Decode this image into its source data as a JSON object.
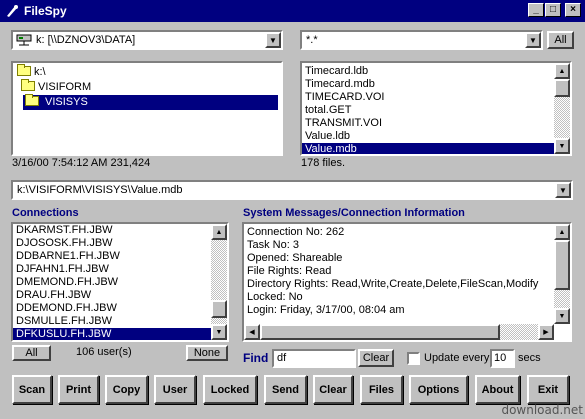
{
  "window": {
    "title": "FileSpy"
  },
  "drive_combo": {
    "value": "k: [\\\\DZNOV3\\DATA]"
  },
  "filter_combo": {
    "value": "*.*"
  },
  "all_button": "All",
  "dir_tree": [
    {
      "label": "k:\\",
      "selected": false
    },
    {
      "label": "VISIFORM",
      "selected": false
    },
    {
      "label": "VISISYS",
      "selected": true
    }
  ],
  "file_list": [
    {
      "label": "Timecard.ldb",
      "selected": false
    },
    {
      "label": "Timecard.mdb",
      "selected": false
    },
    {
      "label": "TIMECARD.VOI",
      "selected": false
    },
    {
      "label": "total.GET",
      "selected": false
    },
    {
      "label": "TRANSMIT.VOI",
      "selected": false
    },
    {
      "label": "Value.ldb",
      "selected": false
    },
    {
      "label": "Value.mdb",
      "selected": true
    }
  ],
  "file_info": "3/16/00 7:54:12 AM  231,424",
  "file_count": "178 files.",
  "path_combo": {
    "value": "k:\\VISIFORM\\VISISYS\\Value.mdb"
  },
  "connections": {
    "heading": "Connections",
    "items": [
      {
        "label": "DKARMST.FH.JBW",
        "selected": false
      },
      {
        "label": "DJOSOSK.FH.JBW",
        "selected": false
      },
      {
        "label": "DDBARNE1.FH.JBW",
        "selected": false
      },
      {
        "label": "DJFAHN1.FH.JBW",
        "selected": false
      },
      {
        "label": "DMEMOND.FH.JBW",
        "selected": false
      },
      {
        "label": "DRAU.FH.JBW",
        "selected": false
      },
      {
        "label": "DDEMOND.FH.JBW",
        "selected": false
      },
      {
        "label": "DSMULLE.FH.JBW",
        "selected": false
      },
      {
        "label": "DFKUSLU.FH.JBW",
        "selected": true
      }
    ],
    "all_label": "All",
    "user_count": "106 user(s)",
    "none_label": "None"
  },
  "system_messages": {
    "heading": "System Messages/Connection Information",
    "lines": [
      "Connection No: 262",
      "Task No: 3",
      "Opened: Shareable",
      "File Rights: Read",
      "Directory Rights: Read,Write,Create,Delete,FileScan,Modify",
      "Locked: No",
      "Login: Friday, 3/17/00, 08:04 am"
    ]
  },
  "find": {
    "label": "Find",
    "value": "df",
    "clear_label": "Clear",
    "update_label": "Update every",
    "update_checked": false,
    "interval": "10",
    "secs_label": "secs"
  },
  "toolbar": [
    {
      "name": "scan-button",
      "label": "Scan"
    },
    {
      "name": "print-button",
      "label": "Print"
    },
    {
      "name": "copy-button",
      "label": "Copy"
    },
    {
      "name": "user-button",
      "label": "User"
    },
    {
      "name": "locked-button",
      "label": "Locked"
    },
    {
      "name": "send-button",
      "label": "Send"
    },
    {
      "name": "clear-button",
      "label": "Clear"
    },
    {
      "name": "files-button",
      "label": "Files"
    },
    {
      "name": "options-button",
      "label": "Options"
    },
    {
      "name": "about-button",
      "label": "About"
    },
    {
      "name": "exit-button",
      "label": "Exit"
    }
  ],
  "watermark": "download.net",
  "colors": {
    "titlebar": "#000080",
    "selection": "#000080",
    "heading": "#000080",
    "face": "#c0c0c0"
  },
  "icons": [
    "app-icon",
    "minimize-icon",
    "maximize-icon",
    "close-icon",
    "network-drive-icon",
    "folder-icon"
  ]
}
